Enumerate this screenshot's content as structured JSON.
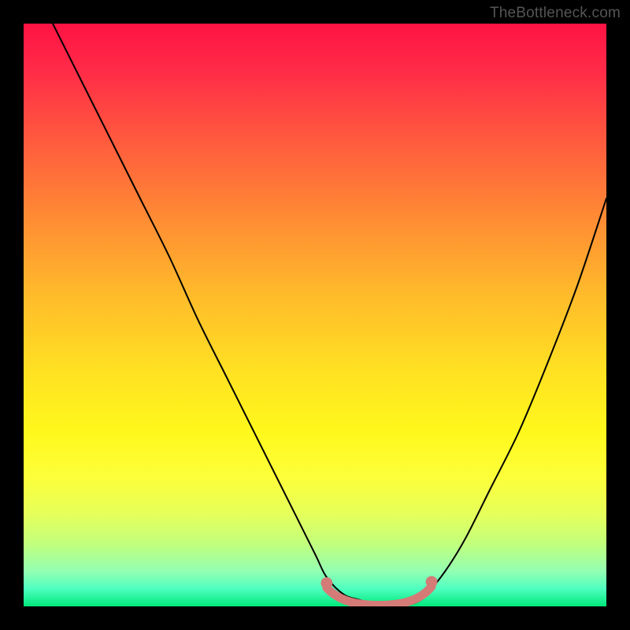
{
  "watermark": {
    "text": "TheBottleneck.com"
  },
  "chart_data": {
    "type": "line",
    "title": "",
    "xlabel": "",
    "ylabel": "",
    "xlim": [
      0,
      100
    ],
    "ylim": [
      0,
      100
    ],
    "grid": false,
    "legend": false,
    "colors": {
      "curve": "#000000",
      "highlight": "#d47b77",
      "background_gradient_top": "#ff1344",
      "background_gradient_bottom": "#00e97a"
    },
    "series": [
      {
        "name": "bottleneck-curve",
        "x": [
          5,
          10,
          15,
          20,
          25,
          30,
          35,
          40,
          45,
          50,
          52,
          55,
          58,
          60,
          62,
          65,
          68,
          70,
          73,
          76,
          80,
          85,
          90,
          95,
          100
        ],
        "y": [
          100,
          90,
          80,
          70,
          60,
          49,
          39,
          29,
          19,
          9,
          5,
          2,
          1,
          0,
          0,
          0,
          1,
          3,
          7,
          12,
          20,
          30,
          42,
          55,
          70
        ]
      }
    ],
    "highlight_segment": {
      "note": "Thick salmon arc/points near the curve minimum",
      "x_range": [
        52,
        70
      ],
      "y_approx": 1
    }
  }
}
